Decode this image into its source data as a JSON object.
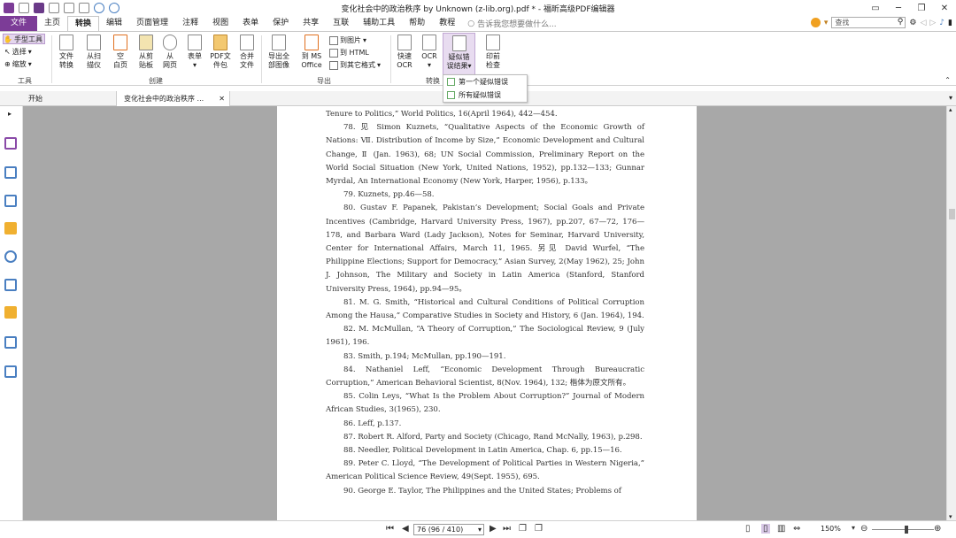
{
  "window": {
    "title": "变化社会中的政治秩序 by Unknown (z-lib.org).pdf * - 福昕高级PDF编辑器"
  },
  "menu": {
    "file": "文件",
    "items": [
      "主页",
      "转换",
      "编辑",
      "页面管理",
      "注释",
      "视图",
      "表单",
      "保护",
      "共享",
      "互联",
      "辅助工具",
      "帮助",
      "教程"
    ],
    "active_index": 1,
    "tell_me": "告诉我您想要做什么...",
    "search_placeholder": "查找"
  },
  "ribbon": {
    "tools": {
      "hand": "手型工具",
      "select": "选择",
      "zoom": "缩放",
      "group": "工具"
    },
    "create": {
      "file_convert": "文件\n转换",
      "from_scanner": "从扫\n描仪",
      "blank_page": "空\n白页",
      "from_clipboard": "从剪\n贴板",
      "from_web": "从\n网页",
      "form": "表单",
      "pdf_package": "PDF文\n件包",
      "merge": "合并\n文件",
      "group": "创建"
    },
    "export": {
      "export_all_images": "导出全\n部图像",
      "to_ms_office": "到 MS\nOffice",
      "to_image": "到图片",
      "to_html": "到 HTML",
      "to_other": "到其它格式",
      "group": "导出"
    },
    "convert": {
      "quick_ocr": "快速\nOCR",
      "ocr": "OCR",
      "suspect": "疑似错\n误结果",
      "preflight": "印前\n检查",
      "group": "转换"
    },
    "dropdown": [
      "第一个疑似错误",
      "所有疑似错误"
    ]
  },
  "tabs": [
    {
      "label": "开始"
    },
    {
      "label": "变化社会中的政治秩序 ..."
    }
  ],
  "document": {
    "paragraphs": [
      {
        "ind": false,
        "text": "Tenure to Politics,” World Politics, 16(April 1964), 442—454."
      },
      {
        "ind": true,
        "text": "78. 见 Simon Kuznets, “Qualitative Aspects of the Economic Growth of Nations: Ⅶ. Distribution of Income by Size,” Economic Development and Cultural Change, Ⅱ (Jan. 1963), 68; UN Social Commission, Preliminary Report on the World Social Situation (New York, United Nations, 1952), pp.132—133; Gunnar Myrdal, An International Economy (New York, Harper, 1956), p.133。"
      },
      {
        "ind": true,
        "text": "79. Kuznets, pp.46—58."
      },
      {
        "ind": true,
        "text": "80. Gustav F. Papanek, Pakistan’s Development; Social Goals and Private Incentives (Cambridge, Harvard University Press, 1967), pp.207, 67—72, 176—178, and Barbara Ward (Lady Jackson), Notes for Seminar, Harvard University, Center for International Affairs, March 11, 1965. 另见 David Wurfel, “The Philippine Elections; Support for Democracy,” Asian Survey, 2(May 1962), 25; John J. Johnson, The Military and Society in Latin America (Stanford, Stanford University Press, 1964), pp.94—95。"
      },
      {
        "ind": true,
        "text": "81. M. G. Smith, “Historical and Cultural Conditions of Political Corruption Among the Hausa,” Comparative Studies in Society and History, 6 (Jan. 1964), 194."
      },
      {
        "ind": true,
        "text": "82. M. McMullan, “A Theory of Corruption,” The Sociological Review, 9 (July 1961), 196."
      },
      {
        "ind": true,
        "text": "83. Smith, p.194; McMullan, pp.190—191."
      },
      {
        "ind": true,
        "text": "84. Nathaniel Leff, “Economic Development Through Bureaucratic Corruption,” American Behavioral Scientist, 8(Nov. 1964), 132; 楷体为原文所有。"
      },
      {
        "ind": true,
        "text": "85. Colin Leys, “What Is the Problem About Corruption?” Journal of Modern African Studies, 3(1965), 230."
      },
      {
        "ind": true,
        "text": "86. Leff, p.137."
      },
      {
        "ind": true,
        "text": "87. Robert R. Alford, Party and Society (Chicago, Rand McNally, 1963), p.298."
      },
      {
        "ind": true,
        "text": "88. Needler, Political Development in Latin America, Chap. 6, pp.15—16."
      },
      {
        "ind": true,
        "text": "89. Peter C. Lloyd, “The Development of Political Parties in Western Nigeria,” American Political Science Review, 49(Sept. 1955), 695."
      },
      {
        "ind": true,
        "text": "90. George E. Taylor, The Philippines and the United States; Problems of"
      }
    ]
  },
  "status": {
    "page_box": "76 (96 / 410)",
    "zoom": "150%"
  },
  "colors": {
    "accent": "#7c3c97"
  }
}
